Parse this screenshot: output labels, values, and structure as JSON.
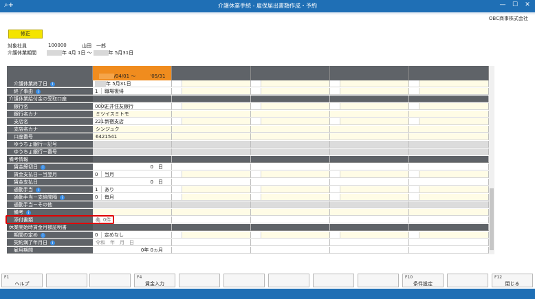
{
  "window": {
    "title": "介護休業手続 - 雇保届出書類作成・予約",
    "left_icon": "⌕+",
    "controls": [
      "—",
      "☐",
      "✕"
    ]
  },
  "company": "OBC商事株式会社",
  "mode_button": "修正",
  "employee": {
    "label": "対象社員",
    "code": "100000",
    "name": "山田　一郎"
  },
  "period": {
    "label": "介護休業期間",
    "from_suffix": "年 4月 1日 ～",
    "to_suffix": "年 5月31日"
  },
  "column_header": {
    "text": "/04/01 ～　　　'05/31"
  },
  "rows": [
    {
      "label": "介護休業終了日",
      "info": true,
      "type": "date",
      "v1": "年  5月31日"
    },
    {
      "label": "終了事由",
      "info": true,
      "type": "codecell",
      "code": "1",
      "name": "職場復帰"
    },
    {
      "label": "介護休業給付金の受取口座",
      "section": true
    },
    {
      "label": "銀行名",
      "type": "codecell",
      "code": "0009",
      "name": "三井住友銀行"
    },
    {
      "label": "銀行名カナ",
      "type": "text",
      "v1": "ミツイスミトモ"
    },
    {
      "label": "支店名",
      "type": "codecell",
      "code": "221",
      "name": "新宿支店"
    },
    {
      "label": "支店名カナ",
      "type": "text",
      "v1": "シンジュク"
    },
    {
      "label": "口座番号",
      "type": "text",
      "v1": "6421541"
    },
    {
      "label": "ゆうちょ銀行－記号",
      "type": "gray"
    },
    {
      "label": "ゆうちょ銀行－番号",
      "type": "gray"
    },
    {
      "label": "備考情報",
      "section": true
    },
    {
      "label": "賃金締切日",
      "info": true,
      "type": "right",
      "v1": "0　日"
    },
    {
      "label": "賃金支払日－当翌月",
      "type": "codecell",
      "code": "0",
      "name": "当月"
    },
    {
      "label": "賃金支払日",
      "type": "right",
      "v1": "0　日"
    },
    {
      "label": "通勤手当",
      "info": true,
      "type": "codecell",
      "code": "1",
      "name": "あり"
    },
    {
      "label": "通勤手当－支給間隔",
      "info": true,
      "type": "codecell",
      "code": "0",
      "name": "毎月"
    },
    {
      "label": "通勤手当－その他",
      "type": "gray"
    },
    {
      "label": "備考",
      "info": true,
      "type": "text",
      "v1": ""
    },
    {
      "label": "添付書類",
      "type": "attach",
      "v1": "0件"
    },
    {
      "label": "休業開始時賃金月額証明書",
      "section": true
    },
    {
      "label": "期間の定め",
      "info": true,
      "type": "codecell",
      "code": "0",
      "name": "定めなし"
    },
    {
      "label": "契約満了年月日",
      "info": true,
      "type": "era",
      "v1": "令和　年　月　日"
    },
    {
      "label": "雇用期間",
      "type": "right",
      "v1": "0年  0ヵ月"
    }
  ],
  "fkeys": [
    {
      "key": "F1",
      "label": "ヘルプ"
    },
    {
      "key": "",
      "label": ""
    },
    {
      "key": "",
      "label": ""
    },
    {
      "key": "F4",
      "label": "賃金入力"
    },
    {
      "key": "",
      "label": ""
    },
    {
      "key": "",
      "label": ""
    },
    {
      "key": "",
      "label": ""
    },
    {
      "key": "",
      "label": ""
    },
    {
      "key": "",
      "label": ""
    },
    {
      "key": "F10",
      "label": "条件設定"
    },
    {
      "key": "",
      "label": ""
    },
    {
      "key": "F12",
      "label": "閉じる"
    }
  ]
}
